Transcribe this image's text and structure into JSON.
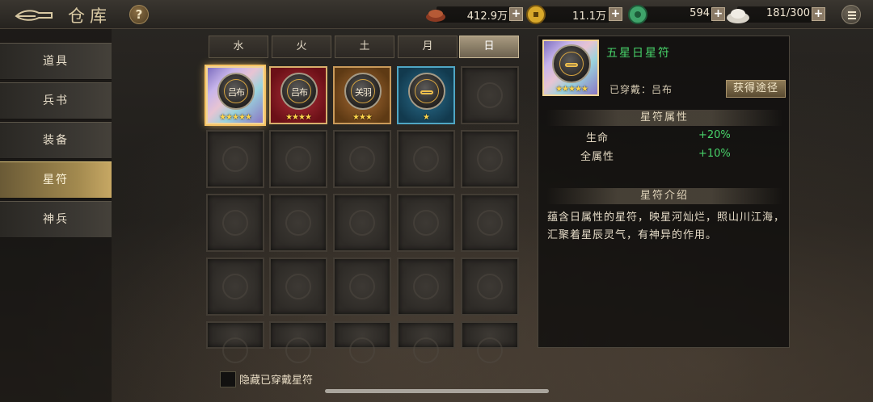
{
  "header": {
    "title": "仓库",
    "help_label": "?",
    "resources": [
      {
        "name": "copper",
        "icon": "copper-ingot-icon",
        "value": "412.9万"
      },
      {
        "name": "gold",
        "icon": "gold-coin-icon",
        "value": "11.1万"
      },
      {
        "name": "jade",
        "icon": "jade-coin-icon",
        "value": "594"
      },
      {
        "name": "food",
        "icon": "rice-pile-icon",
        "value": "181/300"
      }
    ],
    "plus_label": "+"
  },
  "sidebar": {
    "items": [
      {
        "label": "道具",
        "active": false
      },
      {
        "label": "兵书",
        "active": false
      },
      {
        "label": "装备",
        "active": false
      },
      {
        "label": "星符",
        "active": true
      },
      {
        "label": "神兵",
        "active": false
      }
    ]
  },
  "tabs": [
    {
      "label": "水",
      "active": false
    },
    {
      "label": "火",
      "active": false
    },
    {
      "label": "土",
      "active": false
    },
    {
      "label": "月",
      "active": false
    },
    {
      "label": "日",
      "active": true
    }
  ],
  "grid": {
    "items": [
      {
        "name": "吕布",
        "stars": 5,
        "quality": "q5",
        "selected": true
      },
      {
        "name": "吕布",
        "stars": 4,
        "quality": "q4",
        "selected": false
      },
      {
        "name": "关羽",
        "stars": 3,
        "quality": "q3",
        "selected": false
      },
      {
        "name": "",
        "stars": 1,
        "quality": "q1",
        "selected": false
      }
    ]
  },
  "hide_equipped": {
    "label": "隐藏已穿戴星符",
    "checked": false
  },
  "detail": {
    "name": "五星日星符",
    "equipped_text": "已穿戴：吕布",
    "source_button": "获得途径",
    "attr_section": "星符属性",
    "attributes": [
      {
        "name": "生命",
        "value": "+20%"
      },
      {
        "name": "全属性",
        "value": "+10%"
      }
    ],
    "intro_section": "星符介绍",
    "description": "蕴含日属性的星符，映星河灿烂，照山川江海，汇聚着星辰灵气，有神异的作用。",
    "stars": 5
  },
  "colors": {
    "accent_gold": "#c7a864",
    "attribute_green": "#48d46a",
    "star_yellow": "#ffd54a"
  }
}
